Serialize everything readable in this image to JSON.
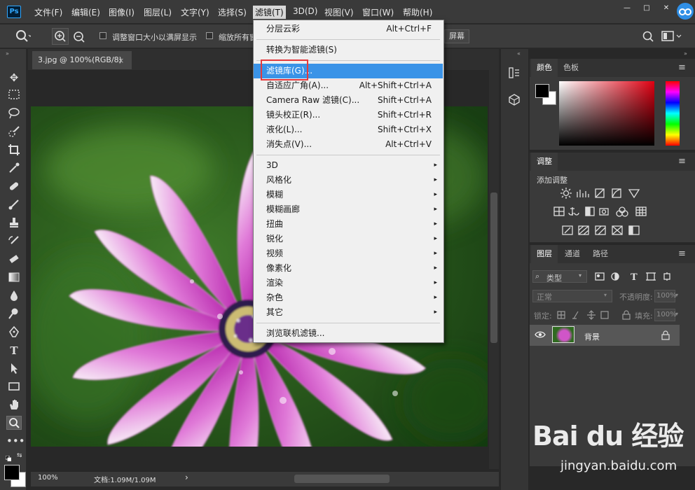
{
  "menubar": {
    "logo": "Ps",
    "items": [
      "文件(F)",
      "编辑(E)",
      "图像(I)",
      "图层(L)",
      "文字(Y)",
      "选择(S)",
      "滤镜(T)",
      "3D(D)",
      "视图(V)",
      "窗口(W)",
      "帮助(H)"
    ],
    "window_controls": [
      "—",
      "□",
      "✕"
    ]
  },
  "optbar": {
    "opt1": "调整窗口大小以满屏显示",
    "opt2": "缩放所有窗",
    "fill_screen": "屏幕"
  },
  "document": {
    "tab_title": "3.jpg @ 100%(RGB/8)",
    "tab_close": "×"
  },
  "status": {
    "zoom": "100%",
    "doc_size": "文档:1.09M/1.09M",
    "arrow": "›"
  },
  "panels": {
    "color_tabs": [
      "颜色",
      "色板"
    ],
    "adjust_tab": "调整",
    "adjust_add": "添加调整",
    "layer_tabs": [
      "图层",
      "通道",
      "路径"
    ],
    "layer_filter": "类型",
    "blend_mode": "正常",
    "opacity_label": "不透明度:",
    "opacity_value": "100%",
    "lock_label": "锁定:",
    "fill_label": "填充:",
    "fill_value": "100%",
    "layer_name": "背景"
  },
  "filter_menu": {
    "items": [
      {
        "label": "分层云彩",
        "shortcut": "Alt+Ctrl+F"
      },
      {
        "label": "转换为智能滤镜(S)",
        "shortcut": ""
      },
      {
        "label": "滤镜库(G)...",
        "shortcut": ""
      },
      {
        "label": "自适应广角(A)...",
        "shortcut": "Alt+Shift+Ctrl+A"
      },
      {
        "label": "Camera Raw 滤镜(C)...",
        "shortcut": "Shift+Ctrl+A"
      },
      {
        "label": "镜头校正(R)...",
        "shortcut": "Shift+Ctrl+R"
      },
      {
        "label": "液化(L)...",
        "shortcut": "Shift+Ctrl+X"
      },
      {
        "label": "消失点(V)...",
        "shortcut": "Alt+Ctrl+V"
      },
      {
        "label": "3D",
        "shortcut": ""
      },
      {
        "label": "风格化",
        "shortcut": ""
      },
      {
        "label": "模糊",
        "shortcut": ""
      },
      {
        "label": "模糊画廊",
        "shortcut": ""
      },
      {
        "label": "扭曲",
        "shortcut": ""
      },
      {
        "label": "锐化",
        "shortcut": ""
      },
      {
        "label": "视频",
        "shortcut": ""
      },
      {
        "label": "像素化",
        "shortcut": ""
      },
      {
        "label": "渲染",
        "shortcut": ""
      },
      {
        "label": "杂色",
        "shortcut": ""
      },
      {
        "label": "其它",
        "shortcut": ""
      },
      {
        "label": "浏览联机滤镜...",
        "shortcut": ""
      }
    ],
    "submenu_arrow": "▸"
  },
  "watermark": {
    "brand": "Bai du 经验",
    "url": "jingyan.baidu.com"
  }
}
